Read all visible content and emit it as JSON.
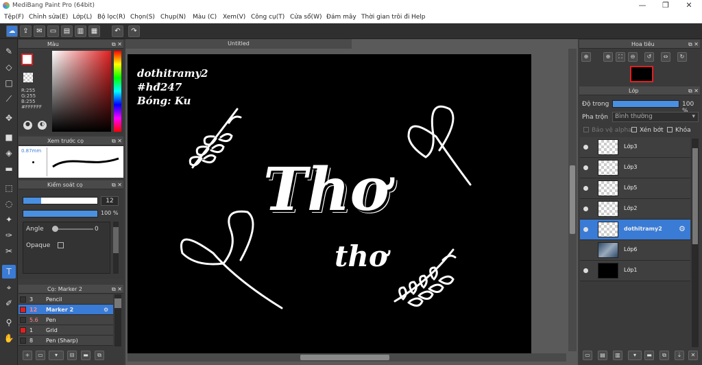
{
  "window": {
    "title": "MediBang Paint Pro (64bit)",
    "min": "—",
    "max": "❐",
    "close": "✕"
  },
  "menu": [
    "Tệp(F)",
    "Chỉnh sửa(E)",
    "Lớp(L)",
    "Bộ lọc(R)",
    "Chọn(S)",
    "Chụp(N)",
    "Màu (C)",
    "Xem(V)",
    "Công cụ(T)",
    "Cửa sổ(W)",
    "Đám mây",
    "Thời gian trôi đi",
    "Help"
  ],
  "color_panel": {
    "title": "Màu",
    "r": "R:255",
    "g": "G:255",
    "b": "B:255",
    "hex": "#FFFFFF"
  },
  "brush_preview": {
    "title": "Xem trước cọ",
    "size": "0.87mm"
  },
  "brush_control": {
    "title": "Kiểm soát cọ",
    "size": "12",
    "opacity": "100 %",
    "angle_label": "Angle",
    "angle_value": "0",
    "opaque_label": "Opaque"
  },
  "brush_list": {
    "title": "Cọ: Marker 2",
    "items": [
      {
        "size": "3",
        "name": "Pencil",
        "color": "#333333"
      },
      {
        "size": "12",
        "name": "Marker 2",
        "color": "#e02020"
      },
      {
        "size": "5.6",
        "name": "Pen",
        "color": "#333333"
      },
      {
        "size": "1",
        "name": "Grid",
        "color": "#e02020"
      },
      {
        "size": "8",
        "name": "Pen (Sharp)",
        "color": "#333333"
      }
    ]
  },
  "document": {
    "tab": "Untitled"
  },
  "canvas_text": {
    "line1": "dothitramy2",
    "line2": "#hđ247",
    "line3": "Bóng: Ku",
    "big": "Thơ",
    "small": "thơ"
  },
  "navigator": {
    "title": "Hoa tiêu"
  },
  "layer_panel": {
    "title": "Lớp",
    "opacity_label": "Độ trong",
    "opacity_value": "100 %",
    "blend_label": "Pha trộn",
    "blend_value": "Bình thường",
    "protect_alpha": "Bảo vệ alpha",
    "clipping": "Xén bớt",
    "lock": "Khóa",
    "layers": [
      "Lớp3",
      "Lớp3",
      "Lớp5",
      "Lớp2",
      "dothitramy2",
      "Lớp6",
      "Lớp1"
    ]
  },
  "colors": {
    "accent": "#3a7bd5",
    "canvas": "#000000",
    "panel": "#3a3a3a"
  }
}
